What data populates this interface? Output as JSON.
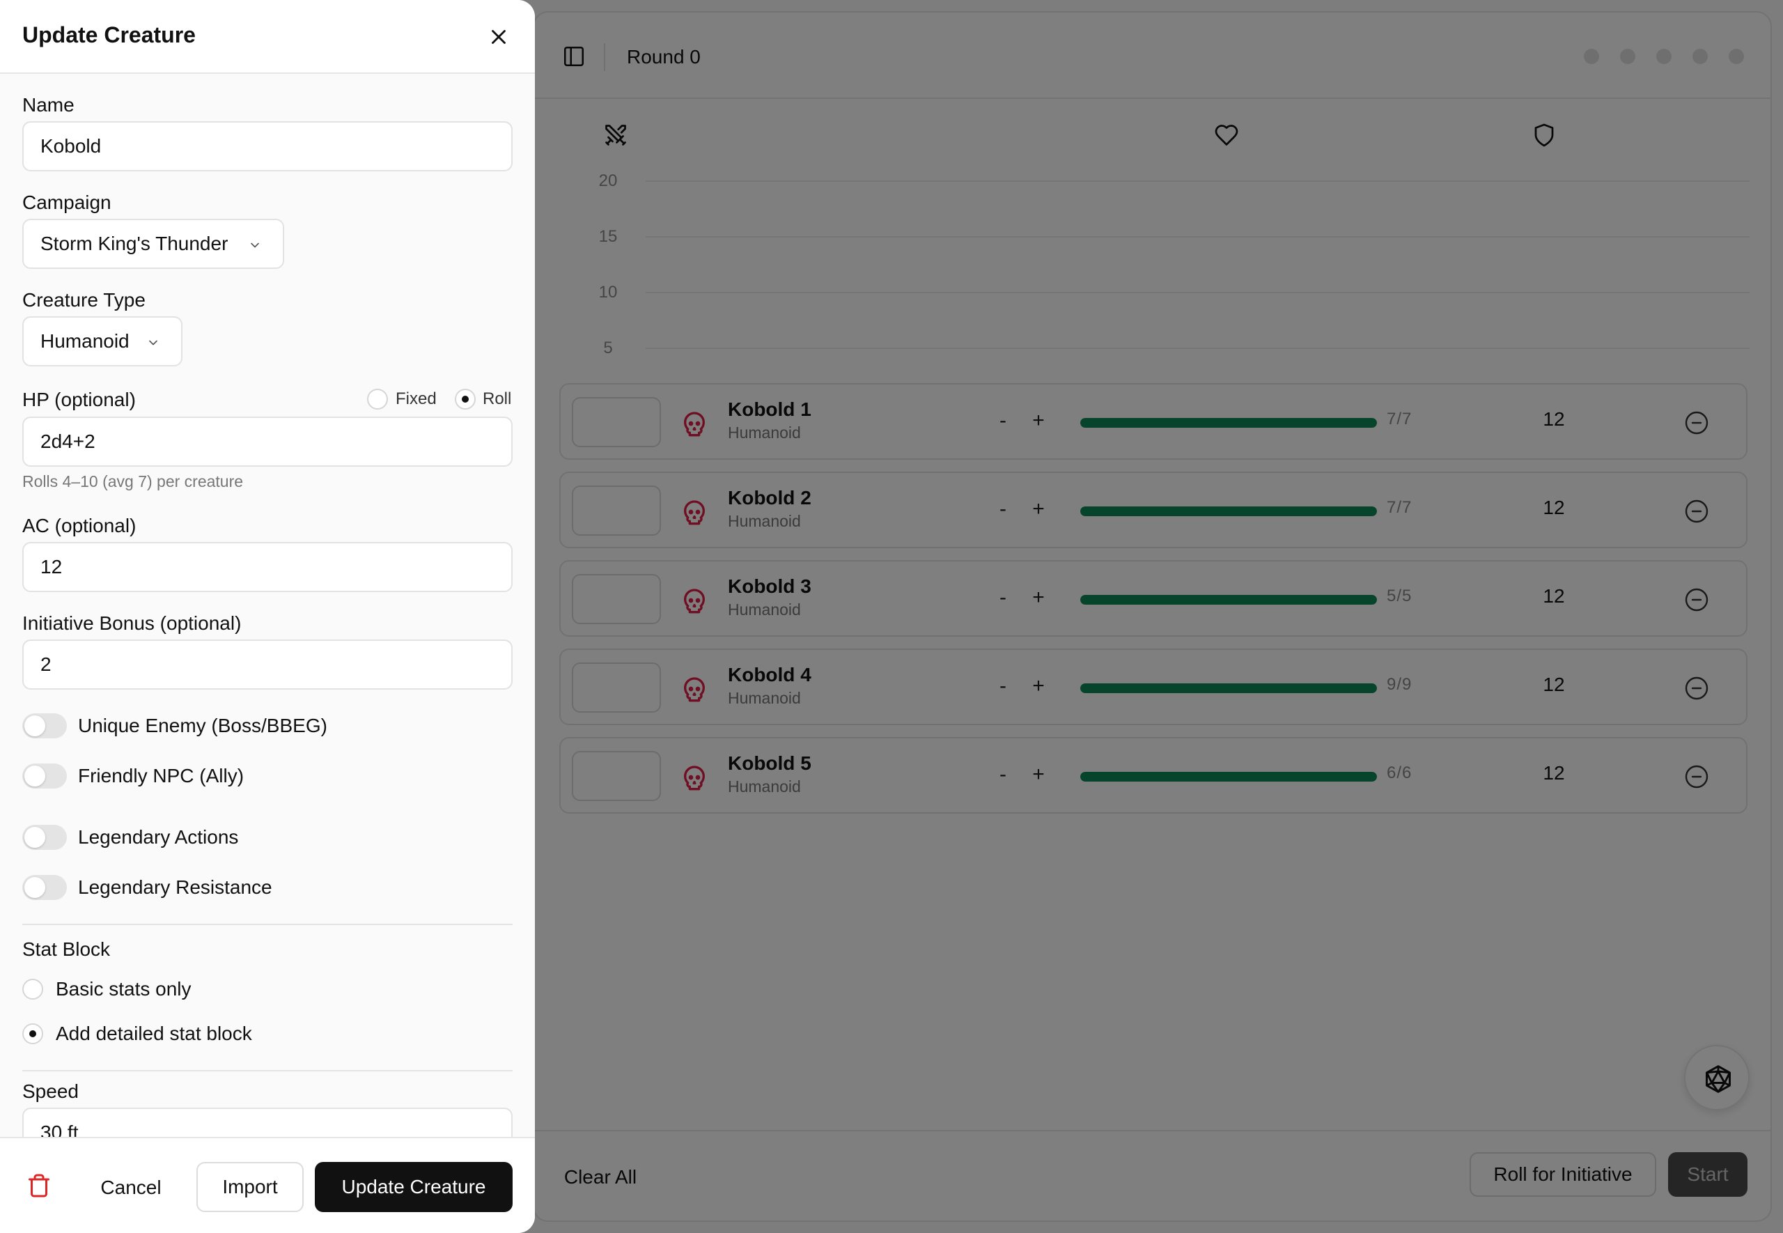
{
  "topbar": {
    "round_label": "Round 0"
  },
  "chart": {
    "y_ticks": [
      "20",
      "15",
      "10",
      "5"
    ]
  },
  "rows": [
    {
      "name": "Kobold 1",
      "type": "Humanoid",
      "minus": "-",
      "plus": "+",
      "hp_text": "7/7",
      "hp_current": 7,
      "hp_max": 7,
      "ac": "12"
    },
    {
      "name": "Kobold 2",
      "type": "Humanoid",
      "minus": "-",
      "plus": "+",
      "hp_text": "7/7",
      "hp_current": 7,
      "hp_max": 7,
      "ac": "12"
    },
    {
      "name": "Kobold 3",
      "type": "Humanoid",
      "minus": "-",
      "plus": "+",
      "hp_text": "5/5",
      "hp_current": 5,
      "hp_max": 5,
      "ac": "12"
    },
    {
      "name": "Kobold 4",
      "type": "Humanoid",
      "minus": "-",
      "plus": "+",
      "hp_text": "9/9",
      "hp_current": 9,
      "hp_max": 9,
      "ac": "12"
    },
    {
      "name": "Kobold 5",
      "type": "Humanoid",
      "minus": "-",
      "plus": "+",
      "hp_text": "6/6",
      "hp_current": 6,
      "hp_max": 6,
      "ac": "12"
    }
  ],
  "bottombar": {
    "clear_all": "Clear All",
    "roll_initiative": "Roll for Initiative",
    "start": "Start"
  },
  "drawer": {
    "title": "Update Creature",
    "name_label": "Name",
    "name_value": "Kobold",
    "campaign_label": "Campaign",
    "campaign_value": "Storm King's Thunder",
    "creature_type_label": "Creature Type",
    "creature_type_value": "Humanoid",
    "hp_label": "HP (optional)",
    "hp_fixed": "Fixed",
    "hp_roll": "Roll",
    "hp_value": "2d4+2",
    "hp_helper": "Rolls 4–10 (avg 7) per creature",
    "ac_label": "AC (optional)",
    "ac_value": "12",
    "init_label": "Initiative Bonus (optional)",
    "init_value": "2",
    "toggles": {
      "unique_enemy": "Unique Enemy (Boss/BBEG)",
      "friendly_npc": "Friendly NPC (Ally)",
      "legendary_actions": "Legendary Actions",
      "legendary_resistance": "Legendary Resistance"
    },
    "stat_block_label": "Stat Block",
    "stat_basic": "Basic stats only",
    "stat_detailed": "Add detailed stat block",
    "speed_label": "Speed",
    "speed_value": "30 ft",
    "footer": {
      "cancel": "Cancel",
      "import": "Import",
      "update": "Update Creature"
    }
  },
  "colors": {
    "accent": "#111111",
    "hp_bar": "#0c8a56",
    "skull": "#e11d48",
    "trash": "#dc2626"
  }
}
